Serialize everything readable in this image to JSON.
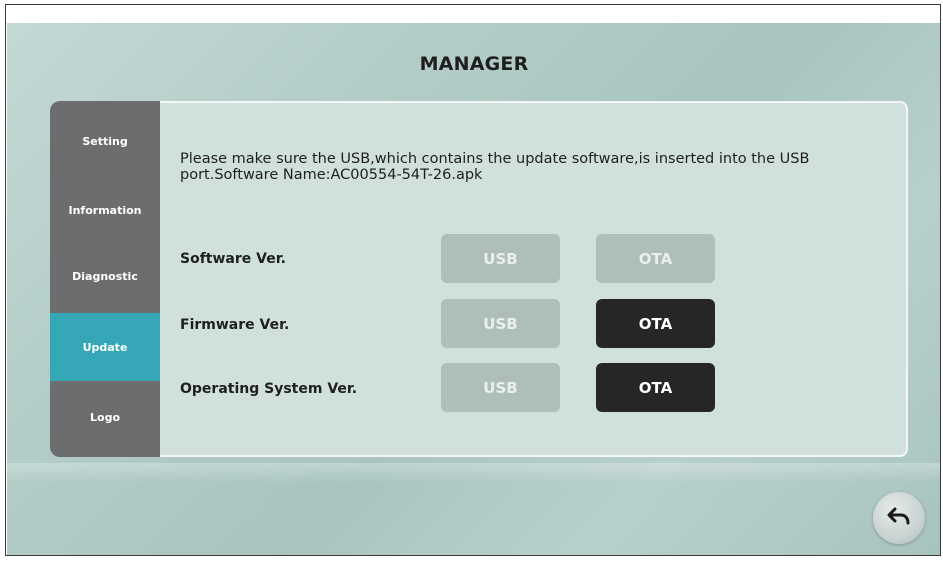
{
  "header": {
    "title": "MANAGER"
  },
  "sidebar": {
    "items": [
      {
        "label": "Setting",
        "active": false
      },
      {
        "label": "Information",
        "active": false
      },
      {
        "label": "Diagnostic",
        "active": false
      },
      {
        "label": "Update",
        "active": true
      },
      {
        "label": "Logo",
        "active": false
      }
    ]
  },
  "update": {
    "notice": "Please make sure the USB,which contains the update software,is inserted into the USB port.Software Name:AC00554-54T-26.apk",
    "rows": [
      {
        "label": "Software Ver.",
        "usb": {
          "label": "USB",
          "enabled": false
        },
        "ota": {
          "label": "OTA",
          "enabled": false
        }
      },
      {
        "label": "Firmware Ver.",
        "usb": {
          "label": "USB",
          "enabled": false
        },
        "ota": {
          "label": "OTA",
          "enabled": true
        }
      },
      {
        "label": "Operating System Ver.",
        "usb": {
          "label": "USB",
          "enabled": false
        },
        "ota": {
          "label": "OTA",
          "enabled": true
        }
      }
    ]
  },
  "footer": {
    "back_icon": "return-arrow-icon"
  },
  "colors": {
    "accent": "#36a7b6",
    "sidebar": "#6b6d6e",
    "button_enabled": "#262626",
    "button_disabled": "#aebebb"
  }
}
